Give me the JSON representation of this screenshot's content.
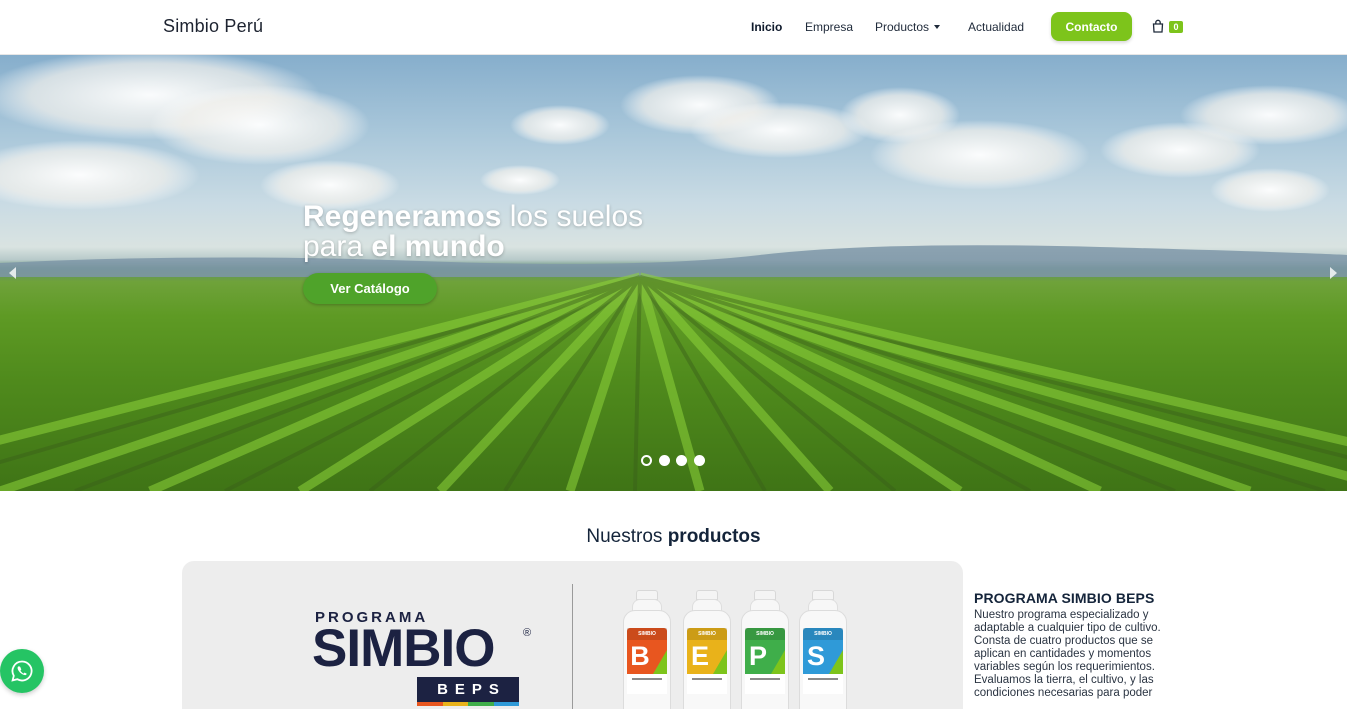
{
  "header": {
    "brand": "Simbio Perú",
    "nav": [
      {
        "label": "Inicio",
        "active": true
      },
      {
        "label": "Empresa",
        "active": false
      },
      {
        "label": "Productos",
        "active": false,
        "dropdown": true
      },
      {
        "label": "Actualidad",
        "active": false
      }
    ],
    "contact_label": "Contacto",
    "cart_count": "0",
    "cart_icon": "shopping-bag-icon"
  },
  "hero": {
    "title_bold_1": "Regeneramos",
    "title_light_1": " los suelos",
    "title_light_2": "para ",
    "title_bold_2": "el mundo",
    "button_label": "Ver Catálogo",
    "slides_count": 4,
    "active_slide": 1
  },
  "products": {
    "heading_light": "Nuestros ",
    "heading_bold": "productos",
    "card": {
      "program_small": "PROGRAMA",
      "program_big": "SIMBIO",
      "registered": "®",
      "beps": "BEPS",
      "bottles": [
        {
          "brand": "SIMBIO",
          "letter": "B",
          "color": "#e8561f"
        },
        {
          "brand": "SIMBIO",
          "letter": "E",
          "color": "#e9b21a"
        },
        {
          "brand": "SIMBIO",
          "letter": "P",
          "color": "#3fae4a"
        },
        {
          "brand": "SIMBIO",
          "letter": "S",
          "color": "#2f9ad8"
        }
      ]
    },
    "title": "PROGRAMA SIMBIO BEPS",
    "description": "Nuestro programa especializado y adaptable a cualquier tipo de cultivo. Consta de cuatro productos que se aplican en cantidades y momentos variables según los requerimientos. Evaluamos la tierra, el cultivo, y las condiciones necesarias para poder"
  },
  "colors": {
    "accent_green": "#7dc41b",
    "button_green": "#4fa32a",
    "navy": "#14243a",
    "whatsapp": "#25c464"
  },
  "whatsapp_icon": "whatsapp-icon"
}
